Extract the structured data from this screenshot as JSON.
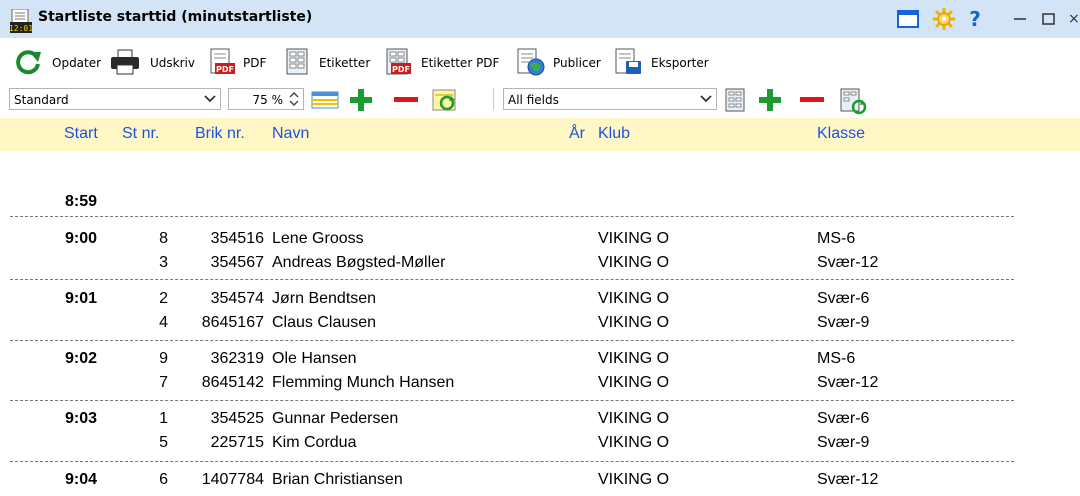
{
  "window": {
    "title": "Startliste starttid (minutstartliste)",
    "icon_text": "12:01",
    "close_glyph": "×"
  },
  "toolbar": {
    "refresh_label": "Opdater",
    "print_label": "Udskriv",
    "pdf_label": "PDF",
    "labels_label": "Etiketter",
    "labels_pdf_label": "Etiketter PDF",
    "publish_label": "Publicer",
    "export_label": "Eksporter"
  },
  "filters": {
    "layout_value": "Standard",
    "zoom_value": "75 %",
    "fields_value": "All fields"
  },
  "table": {
    "headers": {
      "start": "Start",
      "st_nr": "St nr.",
      "brik_nr": "Brik nr.",
      "navn": "Navn",
      "ar": "År",
      "klub": "Klub",
      "klasse": "Klasse"
    },
    "groups": [
      {
        "time": "8:59",
        "rows": []
      },
      {
        "time": "9:00",
        "rows": [
          {
            "st_nr": "8",
            "brik": "354516",
            "navn": "Lene Grooss",
            "klub": "VIKING O",
            "klasse": "MS-6"
          },
          {
            "st_nr": "3",
            "brik": "354567",
            "navn": "Andreas Bøgsted-Møller",
            "klub": "VIKING O",
            "klasse": "Svær-12"
          }
        ]
      },
      {
        "time": "9:01",
        "rows": [
          {
            "st_nr": "2",
            "brik": "354574",
            "navn": "Jørn Bendtsen",
            "klub": "VIKING O",
            "klasse": "Svær-6"
          },
          {
            "st_nr": "4",
            "brik": "8645167",
            "navn": "Claus Clausen",
            "klub": "VIKING O",
            "klasse": "Svær-9"
          }
        ]
      },
      {
        "time": "9:02",
        "rows": [
          {
            "st_nr": "9",
            "brik": "362319",
            "navn": "Ole Hansen",
            "klub": "VIKING O",
            "klasse": "MS-6"
          },
          {
            "st_nr": "7",
            "brik": "8645142",
            "navn": "Flemming Munch Hansen",
            "klub": "VIKING O",
            "klasse": "Svær-12"
          }
        ]
      },
      {
        "time": "9:03",
        "rows": [
          {
            "st_nr": "1",
            "brik": "354525",
            "navn": "Gunnar Pedersen",
            "klub": "VIKING O",
            "klasse": "Svær-6"
          },
          {
            "st_nr": "5",
            "brik": "225715",
            "navn": "Kim Cordua",
            "klub": "VIKING O",
            "klasse": "Svær-9"
          }
        ]
      },
      {
        "time": "9:04",
        "rows": [
          {
            "st_nr": "6",
            "brik": "1407784",
            "navn": "Brian Christiansen",
            "klub": "VIKING O",
            "klasse": "Svær-12"
          }
        ]
      }
    ]
  },
  "icons": {
    "title": "list-clock-icon",
    "layout": "window-layout-icon",
    "settings": "gear-icon",
    "help": "help-icon",
    "minimize": "minimize-icon",
    "maximize": "maximize-icon",
    "close": "close-icon",
    "refresh": "refresh-icon",
    "print": "printer-icon",
    "pdf": "pdf-icon",
    "labels": "labels-icon",
    "labels_pdf": "labels-pdf-icon",
    "publish": "publish-icon",
    "export": "export-icon"
  },
  "colors": {
    "titlebar_bg": "#d2e4f6",
    "header_bg": "#fff8c4",
    "header_text": "#1a53e0",
    "add_green": "#1c9b2f",
    "remove_red": "#e01515"
  }
}
